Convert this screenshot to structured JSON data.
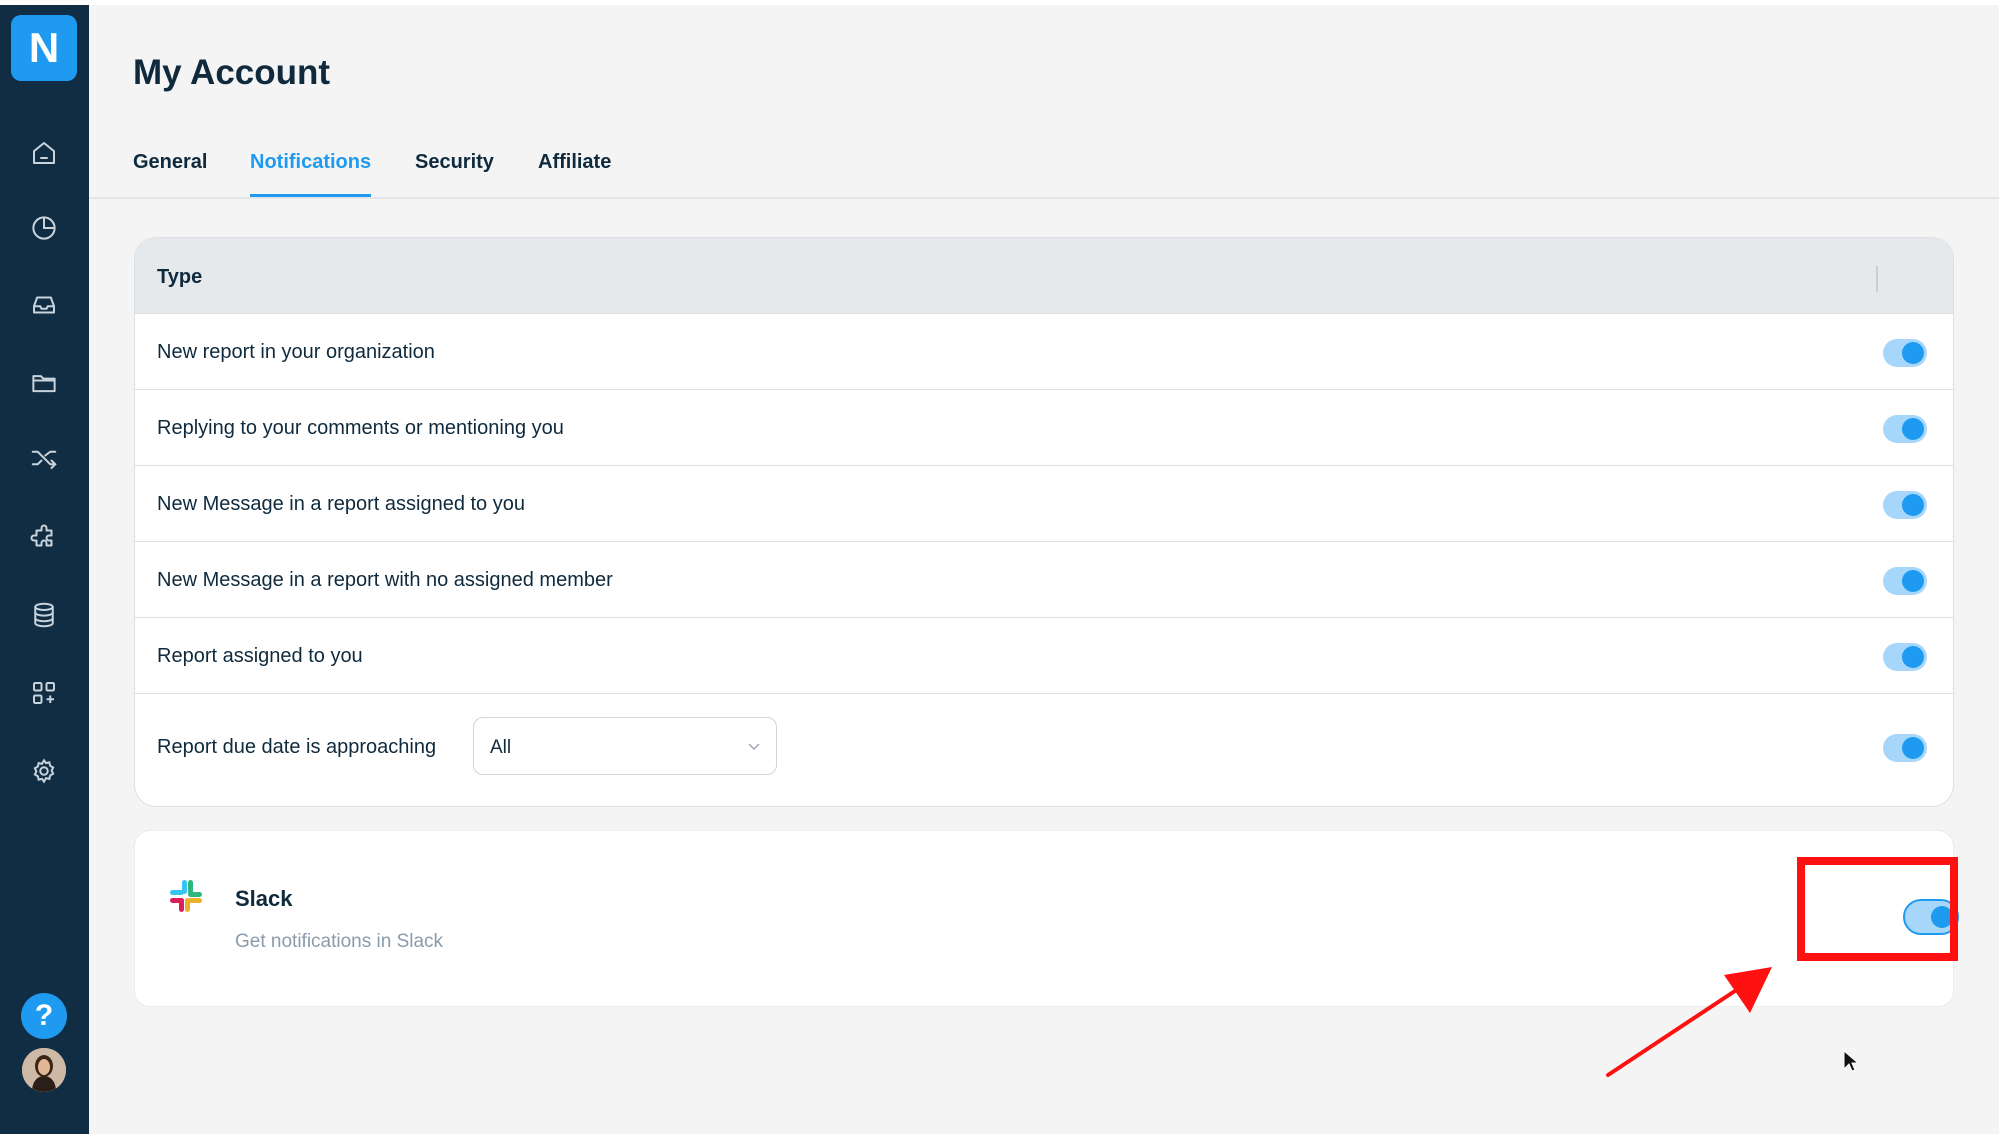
{
  "sidebar": {
    "logo_letter": "N",
    "icons": [
      "home-icon",
      "pie-chart-icon",
      "inbox-icon",
      "folder-icon",
      "shuffle-icon",
      "puzzle-icon",
      "database-icon",
      "apps-add-icon",
      "gear-icon"
    ],
    "help_label": "?"
  },
  "header": {
    "title": "My Account"
  },
  "tabs": [
    {
      "label": "General",
      "active": false
    },
    {
      "label": "Notifications",
      "active": true
    },
    {
      "label": "Security",
      "active": false
    },
    {
      "label": "Affiliate",
      "active": false
    }
  ],
  "notifications": {
    "column_header": "Type",
    "rows": [
      {
        "label": "New report in your organization",
        "enabled": true
      },
      {
        "label": "Replying to your comments or mentioning you",
        "enabled": true
      },
      {
        "label": "New Message in a report assigned to you",
        "enabled": true
      },
      {
        "label": "New Message in a report with no assigned member",
        "enabled": true
      },
      {
        "label": "Report assigned to you",
        "enabled": true
      },
      {
        "label": "Report due date is approaching",
        "enabled": true,
        "select_value": "All"
      }
    ]
  },
  "slack": {
    "title": "Slack",
    "subtitle": "Get notifications in Slack",
    "enabled": true
  },
  "colors": {
    "sidebar": "#112d44",
    "accent": "#1e9bf0",
    "highlight": "#ff1111"
  }
}
